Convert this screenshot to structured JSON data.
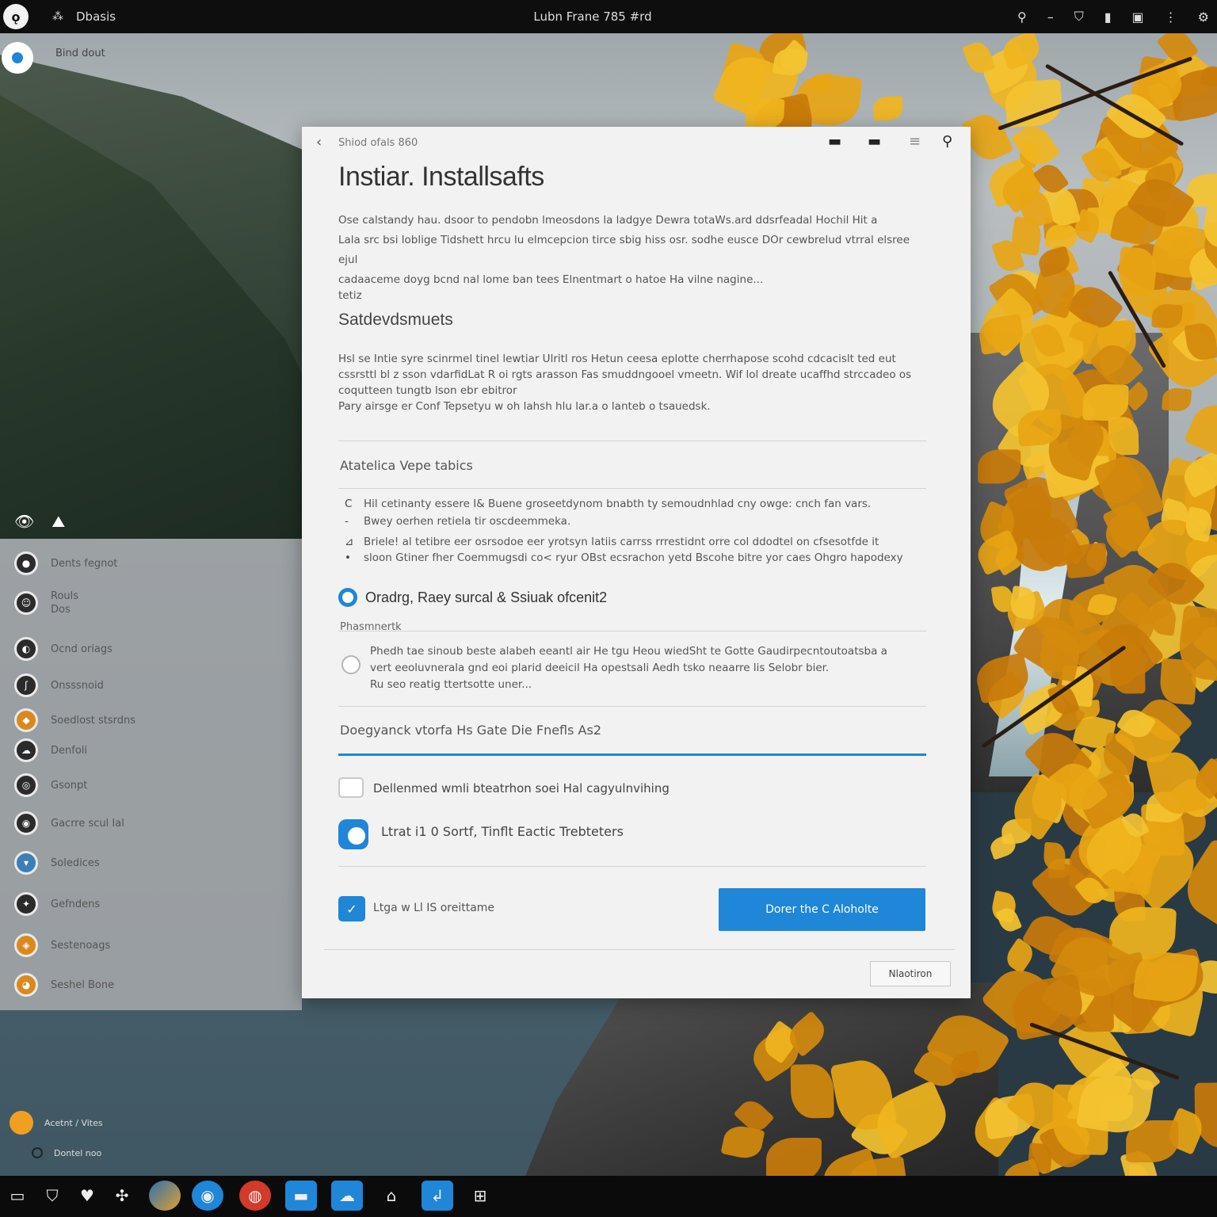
{
  "topbar": {
    "menu_label": "Dbasis",
    "clock": "Lubn Frane 785 #rd"
  },
  "left": {
    "top_title": "Bind dout",
    "items": [
      {
        "label": "Dents fegnot"
      },
      {
        "label": "Rouls\nDos"
      },
      {
        "label": "Ocnd oriags"
      },
      {
        "label": "Onsssnoid"
      },
      {
        "label": "Soedlost stsrdns"
      },
      {
        "label": "Denfoli"
      },
      {
        "label": "Gsonpt"
      },
      {
        "label": "Gacrre scul Ial"
      },
      {
        "label": "Soledices"
      },
      {
        "label": "Gefndens"
      },
      {
        "label": "Sestenoags"
      },
      {
        "label": "Seshel Bone"
      }
    ],
    "bottom": [
      {
        "label": "Acetnt / Vites"
      },
      {
        "label": "Dontel noo"
      }
    ]
  },
  "dialog": {
    "breadcrumb": "Shiod ofals 860",
    "title": "Instiar. Installsafts",
    "intro": [
      "Ose calstandy hau. dsoor to pendobn lmeosdons la ladgye Dewra totaWs.ard ddsrfeadal Hochil Hit a",
      "Lala src bsi loblige Tidshett hrcu lu elmcepcion tirce sbig hiss osr. sodhe eusce DOr cewbrelud vtrral elsree ejul",
      "cadaaceme doyg bcnd nal lome ban tees Elnentmart o hatoe Ha vilne nagine...",
      "tetiz"
    ],
    "section_title": "Satdevdsmuets",
    "section_para": [
      "Hsl se Intie syre scinrmel tinel lewtiar Ulritl ros Hetun ceesa eplotte cherrhapose scohd cdcacislt ted eut",
      "cssrsttl bl z sson vdarfidLat R oi rgts arasson Fas smuddngooel vmeetn. Wif lol dreate ucaffhd strccadeo os",
      "coqutteen tungtb lson ebr ebitror",
      "Pary airsge er Conf Tepsetyu w oh lahsh hlu lar.a o lanteb o tsauedsk."
    ],
    "subsection_title": "Atatelica Vepe tabics",
    "bullets": [
      {
        "mark": "C",
        "text": "Hil cetinanty essere I& Buene groseetdynom bnabth ty semoudnhlad cny owge: cnch fan vars."
      },
      {
        "mark": "-",
        "text": "Bwey oerhen retiela tir oscdeemmeka."
      },
      {
        "mark": "⊿",
        "text": "Briele! al tetibre eer osrsodoe eer yrotsyn Iatiis carrss rrrestidnt orre col ddodtel on cfsesotfde it"
      },
      {
        "mark": "•",
        "text": "sloon Gtiner fher Coemmugsdi co< ryur OBst ecsrachon yetd Bscohe bitre yor caes Ohgro hapodexy"
      }
    ],
    "radio_selected_label": "Oradrg, Raey surcal & Ssiuak ofcenit2",
    "small_label": "Phasmnertk",
    "radio_para": [
      "Phedh tae sinoub beste alabeh eeantl air He tgu Heou wiedSht te Gotte Gaudirpecntoutoatsba a",
      "vert eeoluvnerala gnd eoi plarid deeicil Ha opestsali Aedh tsko neaarre lis Selobr bier.",
      "Ru seo reatig ttertsotte uner..."
    ],
    "field_label": "Doegyanck vtorfa Hs Gate Die Fnefls As2",
    "checkbox_label": "Dellenmed wmli bteatrhon soei Hal cagyulnvihing",
    "toggle_label": "Ltrat i1 0 Sortf, Tinflt Eactic Trebteters",
    "checked_label": "Ltga w Ll IS oreittame",
    "primary_button": "Dorer the C Aloholte",
    "secondary_button": "Nlaotiron"
  },
  "colors": {
    "accent": "#1f86d8",
    "foliage": "#e8a514"
  }
}
